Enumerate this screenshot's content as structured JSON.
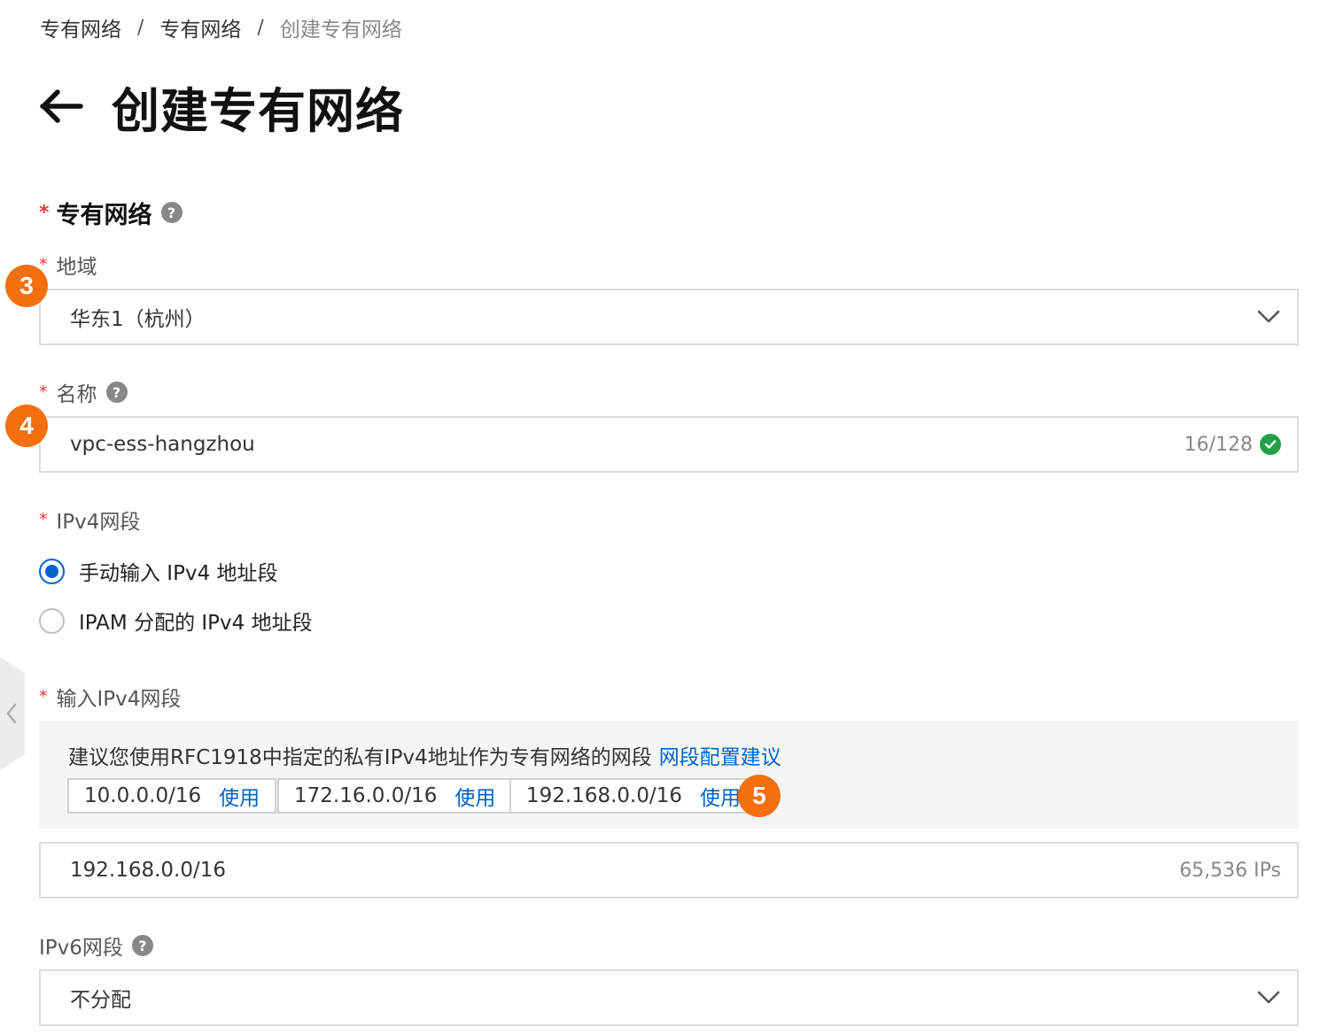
{
  "breadcrumb": {
    "items": [
      "专有网络",
      "专有网络",
      "创建专有网络"
    ],
    "separator": "/"
  },
  "header": {
    "title": "创建专有网络",
    "back_icon": "arrow-left-icon"
  },
  "section": {
    "title": "专有网络",
    "required_mark": "*"
  },
  "region": {
    "label": "地域",
    "value": "华东1（杭州）"
  },
  "name": {
    "label": "名称",
    "value": "vpc-ess-hangzhou",
    "count": "16/128"
  },
  "ipv4": {
    "label": "IPv4网段",
    "options": [
      "手动输入 IPv4 地址段",
      "IPAM 分配的 IPv4 地址段"
    ],
    "selected_index": 0
  },
  "ipv4_input": {
    "label": "输入IPv4网段",
    "suggestion": "建议您使用RFC1918中指定的私有IPv4地址作为专有网络的网段",
    "suggestion_link": "网段配置建议",
    "cidrs": [
      "10.0.0.0/16",
      "172.16.0.0/16",
      "192.168.0.0/16"
    ],
    "use_label": "使用",
    "value": "192.168.0.0/16",
    "ip_count": "65,536 IPs"
  },
  "ipv6": {
    "label": "IPv6网段",
    "value": "不分配"
  },
  "badges": [
    "3",
    "4",
    "5"
  ],
  "colors": {
    "accent": "#0064c8",
    "required": "#e4393c",
    "badge": "#f36f10",
    "success": "#23a046"
  }
}
